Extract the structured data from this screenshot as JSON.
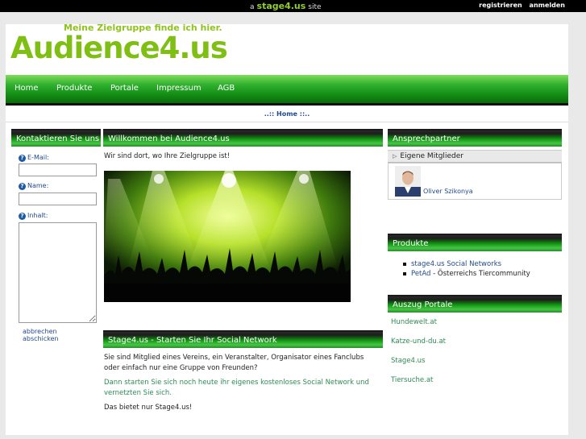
{
  "topbar": {
    "prefix": "a",
    "brand": "stage4.us",
    "suffix": "site",
    "register": "registrieren",
    "login": "anmelden"
  },
  "header": {
    "tagline": "Meine Zielgruppe finde ich hier.",
    "logo": "Audience4.us"
  },
  "nav": {
    "items": [
      "Home",
      "Produkte",
      "Portale",
      "Impressum",
      "AGB"
    ]
  },
  "breadcrumb": "..:: Home ::..",
  "contact": {
    "title": "Kontaktieren Sie uns",
    "email_label": "E-Mail:",
    "name_label": "Name:",
    "content_label": "Inhalt:",
    "cancel": "abbrechen",
    "send": "abschicken"
  },
  "welcome": {
    "title": "Willkommen bei Audience4.us",
    "intro": "Wir sind dort, wo Ihre Zielgruppe ist!"
  },
  "stage": {
    "title": "Stage4.us - Starten Sie Ihr Social Network",
    "p1": "Sie sind Mitglied eines Vereins, ein Veranstalter, Organisator eines Fanclubs oder einfach nur eine Gruppe von Freunden?",
    "p2": "Dann starten Sie sich noch heute ihr eigenes kostenloses Social Network und vernetzten Sie sich.",
    "p3": "Das bietet nur Stage4.us!"
  },
  "contacts": {
    "title": "Ansprechpartner",
    "sub": "Eigene Mitglieder",
    "person": "Oliver Szikonya"
  },
  "products": {
    "title": "Produkte",
    "item1": "stage4.us Social Networks",
    "item2_link": "PetAd",
    "item2_rest": " - Österreichs Tiercommunity"
  },
  "portals": {
    "title": "Auszug Portale",
    "items": [
      "Hundewelt.at",
      "Katze-und-du.at",
      "Stage4.us",
      "Tiersuche.at"
    ]
  },
  "colors": {
    "accent": "#7fbf14",
    "nav_green": "#148e14",
    "link": "#2e8b57"
  }
}
